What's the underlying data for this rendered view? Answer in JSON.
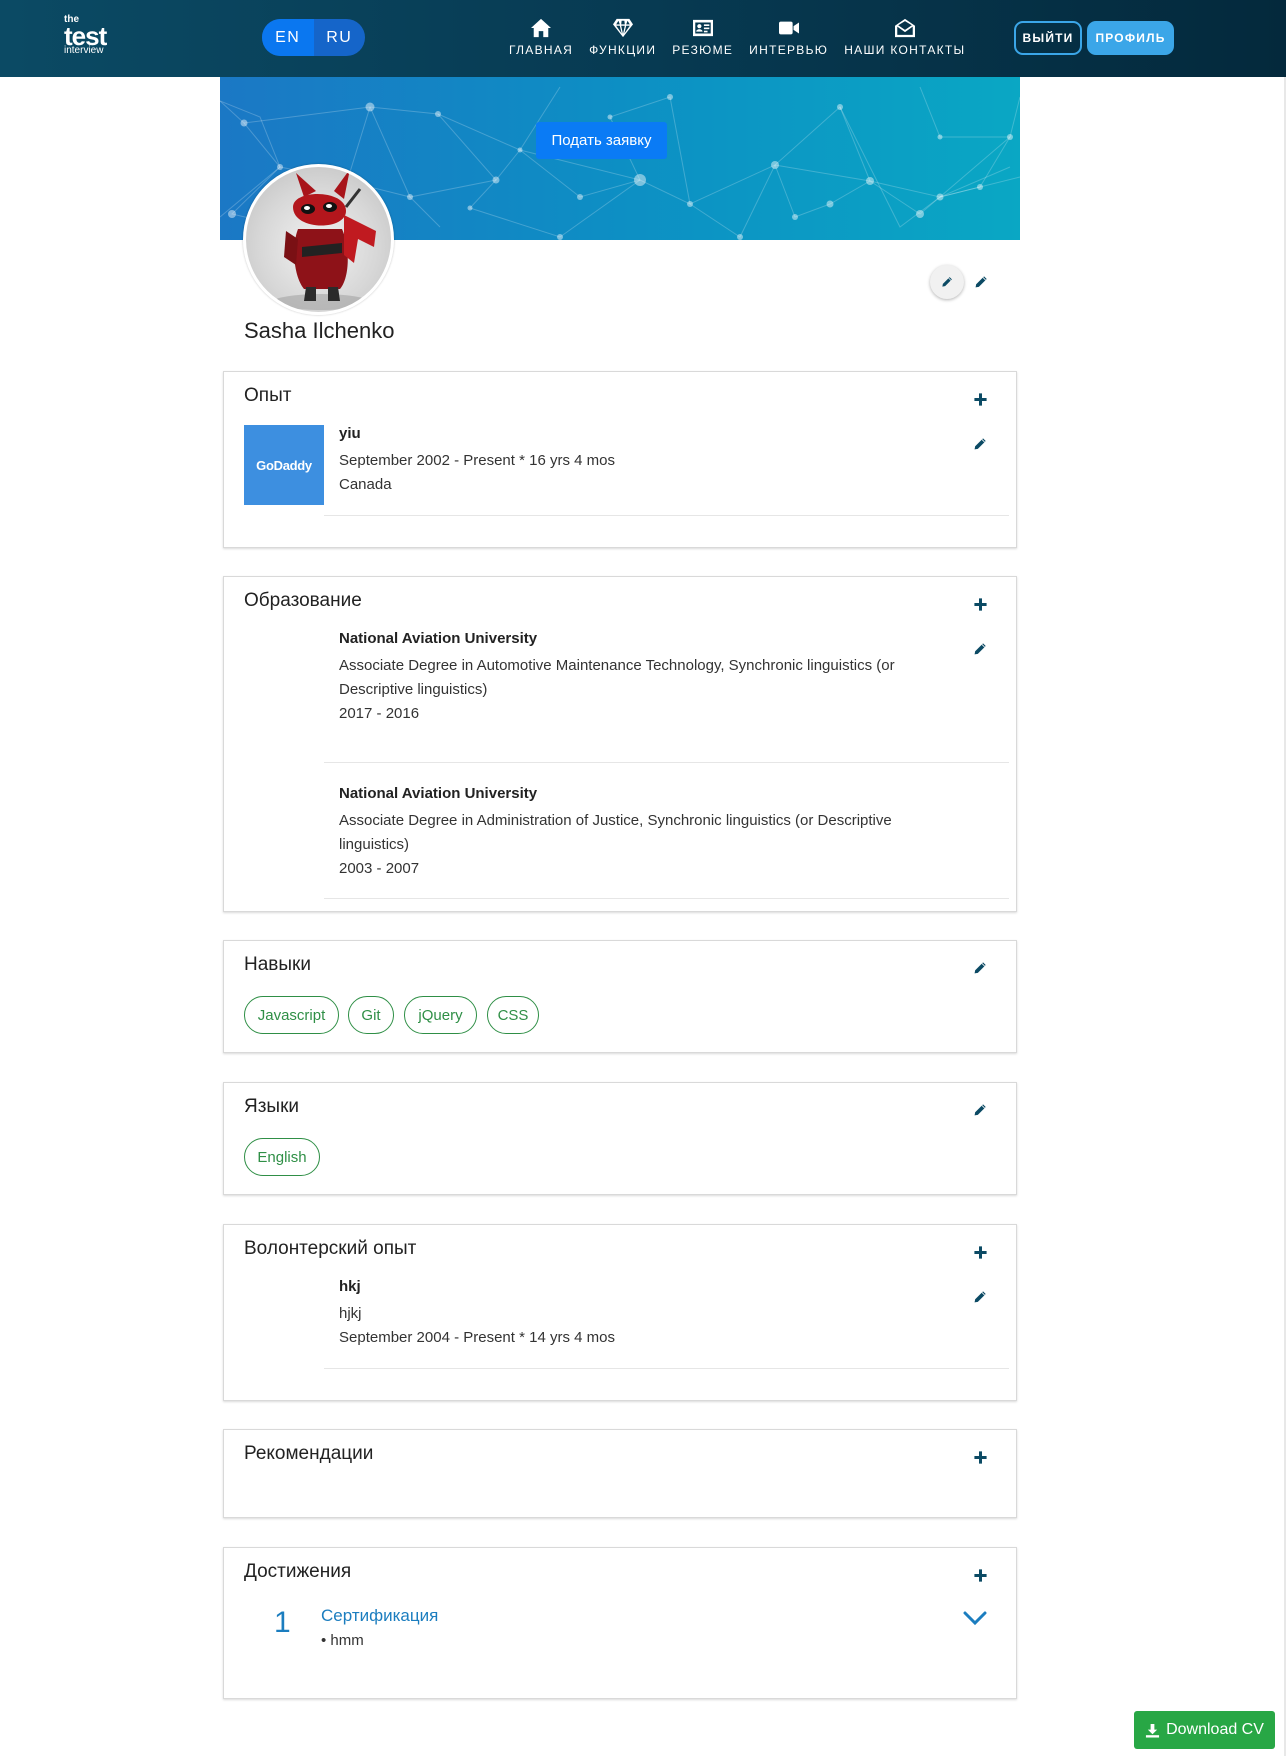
{
  "brand": {
    "line1": "the",
    "line2": "test",
    "line3": "interview"
  },
  "language": {
    "options": [
      "EN",
      "RU"
    ],
    "active": "EN"
  },
  "nav": {
    "items": [
      {
        "label": "ГЛАВНАЯ",
        "icon": "home-icon"
      },
      {
        "label": "ФУНКЦИИ",
        "icon": "diamond-icon"
      },
      {
        "label": "РЕЗЮМЕ",
        "icon": "id-card-icon"
      },
      {
        "label": "ИНТЕРВЬЮ",
        "icon": "video-camera-icon"
      },
      {
        "label": "НАШИ КОНТАКТЫ",
        "icon": "envelope-open-icon"
      }
    ],
    "logout": "ВЫЙТИ",
    "profile": "ПРОФИЛЬ"
  },
  "banner": {
    "apply_button": "Подать заявку"
  },
  "profile": {
    "name": "Sasha Ilchenko"
  },
  "experience": {
    "title": "Опыт",
    "items": [
      {
        "company_logo_text": "GoDaddy",
        "title": "yiu",
        "period": "September 2002 - Present * 16 yrs 4 mos",
        "location": "Canada"
      }
    ]
  },
  "education": {
    "title": "Образование",
    "items": [
      {
        "school": "National Aviation University",
        "degree": "Associate Degree in Automotive Maintenance Technology, Synchronic linguistics (or Descriptive linguistics)",
        "years": "2017 - 2016"
      },
      {
        "school": "National Aviation University",
        "degree": "Associate Degree in Administration of Justice, Synchronic linguistics (or Descriptive linguistics)",
        "years": "2003 - 2007"
      }
    ]
  },
  "skills": {
    "title": "Навыки",
    "tags": [
      "Javascript",
      "Git",
      "jQuery",
      "CSS"
    ]
  },
  "languages": {
    "title": "Языки",
    "tags": [
      "English"
    ]
  },
  "volunteer": {
    "title": "Волонтерский опыт",
    "items": [
      {
        "title": "hkj",
        "role": "hjkj",
        "period": "September 2004 - Present * 14 yrs 4 mos"
      }
    ]
  },
  "recommendations": {
    "title": "Рекомендации"
  },
  "achievements": {
    "title": "Достижения",
    "items": [
      {
        "number": "1",
        "title": "Сертификация",
        "bullet": "• hmm"
      }
    ]
  },
  "download": {
    "label": "Download CV"
  },
  "colors": {
    "navbar": "#073a52",
    "accent": "#3ba6e8",
    "tag_green": "#2f8f46",
    "link_blue": "#1b7dbf",
    "download_green": "#28a745"
  }
}
